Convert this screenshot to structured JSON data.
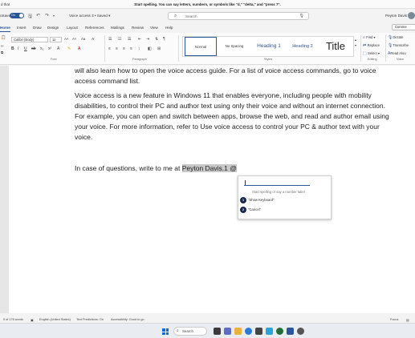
{
  "voice_access": {
    "left_text": "d that",
    "message": "Start spelling. You can say letters, numbers, or symbols like \"d,\" \"delta,\" and \"press 7\"."
  },
  "titlebar": {
    "autosave_label": "oSave",
    "autosave_state": "On",
    "doc_name": "Voice access 3 • Saved ▾",
    "search_placeholder": "Search",
    "user_name": "Peyton Davis"
  },
  "tabs": [
    "Home",
    "Insert",
    "Draw",
    "Design",
    "Layout",
    "References",
    "Mailings",
    "Review",
    "View",
    "Help"
  ],
  "comments_label": "Comme",
  "ribbon": {
    "font_name": "Calibri (Body)",
    "font_size": "11",
    "group_font": "Font",
    "group_paragraph": "Paragraph",
    "group_styles": "Styles",
    "group_editing": "Editing",
    "group_voice": "Voice",
    "styles": [
      "Normal",
      "No Spacing",
      "Heading 1",
      "Heading 2",
      "Title"
    ],
    "find": "Find",
    "replace": "Replace",
    "select": "Select",
    "dictate": "Dictate",
    "transcribe": "Transcribe",
    "read_aloud": "Read Alou"
  },
  "document": {
    "para1": "will also learn how to open the voice access guide. For a list of voice access commands, go to voice access command list.",
    "para2": "Voice access is a new feature in Windows 11 that enables everyone, including people with mobility disabilities, to control their PC and author text using only their voice and without an internet connection. For example, you can open and switch between apps, browse the web, and read and author email using your voice. For more information, refer to Use voice access to control your PC & author text with your voice.",
    "para3_prefix": "In case of questions, write to me at ",
    "para3_selected": "Peyton Davis.1 @"
  },
  "voice_popup": {
    "placeholder": "Start spelling or say a number label",
    "options": [
      {
        "number": "1",
        "label": "\"Show Keyboard\""
      },
      {
        "number": "2",
        "label": "\"Cancel\""
      }
    ]
  },
  "statusbar": {
    "words": "5 of 176 words",
    "language": "English (United States)",
    "predictions": "Text Predictions: On",
    "accessibility": "Accessibility: Good to go",
    "focus": "Focus"
  },
  "taskbar": {
    "search_label": "Search"
  }
}
